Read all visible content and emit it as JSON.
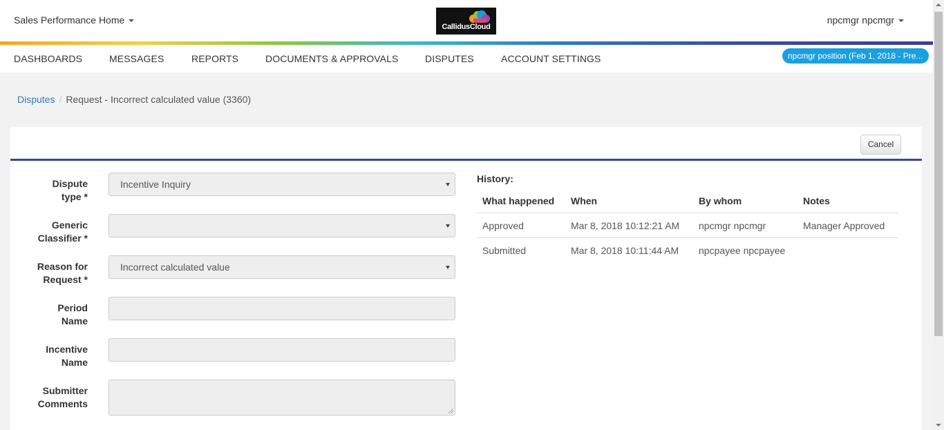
{
  "header": {
    "app_menu_label": "Sales Performance Home",
    "logo_text": "CallidusCloud",
    "user_menu_label": "npcmgr npcmgr"
  },
  "nav": {
    "items": [
      {
        "label": "DASHBOARDS"
      },
      {
        "label": "MESSAGES"
      },
      {
        "label": "REPORTS"
      },
      {
        "label": "DOCUMENTS & APPROVALS"
      },
      {
        "label": "DISPUTES"
      },
      {
        "label": "ACCOUNT SETTINGS"
      }
    ],
    "position_badge": "npcmgr position (Feb 1, 2018 - Pre..."
  },
  "breadcrumb": {
    "parent": "Disputes",
    "separator": "/",
    "current": "Request - Incorrect calculated value (3360)"
  },
  "toolbar": {
    "cancel_label": "Cancel"
  },
  "form": {
    "fields": [
      {
        "label_line1": "Dispute",
        "label_line2": "type *",
        "value": "Incentive Inquiry"
      },
      {
        "label_line1": "Generic",
        "label_line2": "Classifier *",
        "value": ""
      },
      {
        "label_line1": "Reason for",
        "label_line2": "Request *",
        "value": "Incorrect calculated value"
      },
      {
        "label_line1": "Period",
        "label_line2": "Name",
        "value": ""
      },
      {
        "label_line1": "Incentive",
        "label_line2": "Name",
        "value": ""
      },
      {
        "label_line1": "Submitter",
        "label_line2": "Comments",
        "value": ""
      }
    ]
  },
  "history": {
    "title": "History:",
    "columns": [
      "What happened",
      "When",
      "By whom",
      "Notes"
    ],
    "rows": [
      [
        "Approved",
        "Mar 8, 2018 10:12:21 AM",
        "npcmgr npcmgr",
        "Manager Approved"
      ],
      [
        "Submitted",
        "Mar 8, 2018 10:11:44 AM",
        "npcpayee npcpayee",
        ""
      ]
    ]
  },
  "colors": {
    "accent_bar": "#34488f",
    "link": "#337ab7",
    "badge": "#1a9fe0"
  }
}
